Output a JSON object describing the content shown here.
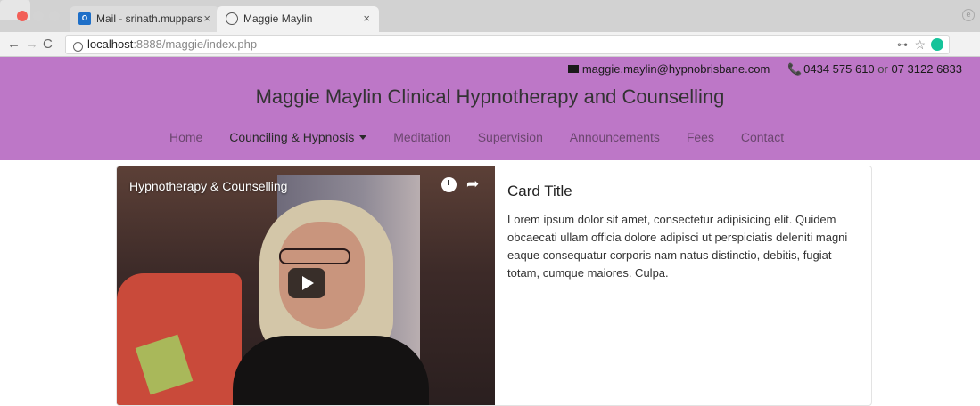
{
  "browser": {
    "tabs": [
      {
        "label": "Mail - srinath.mupparsiravinde",
        "icon": "outlook-icon"
      },
      {
        "label": "Maggie Maylin",
        "icon": "globe-icon"
      }
    ],
    "url_host": "localhost",
    "url_path": ":8888/maggie/index.php"
  },
  "header": {
    "email": "maggie.maylin@hypnobrisbane.com",
    "phone_primary": "0434 575 610",
    "phone_or": "or",
    "phone_secondary": "07 3122 6833",
    "site_title": "Maggie Maylin Clinical Hypnotherapy and Counselling",
    "background": "#bd77c7"
  },
  "nav": {
    "items": [
      {
        "label": "Home"
      },
      {
        "label": "Counciling & Hypnosis"
      },
      {
        "label": "Meditation"
      },
      {
        "label": "Supervision"
      },
      {
        "label": "Announcements"
      },
      {
        "label": "Fees"
      },
      {
        "label": "Contact"
      }
    ]
  },
  "card": {
    "video_title": "Hypnotherapy & Counselling",
    "title": "Card Title",
    "text": "Lorem ipsum dolor sit amet, consectetur adipisicing elit. Quidem obcaecati ullam officia dolore adipisci ut perspiciatis deleniti magni eaque consequatur corporis nam natus distinctio, debitis, fugiat totam, cumque maiores. Culpa."
  }
}
